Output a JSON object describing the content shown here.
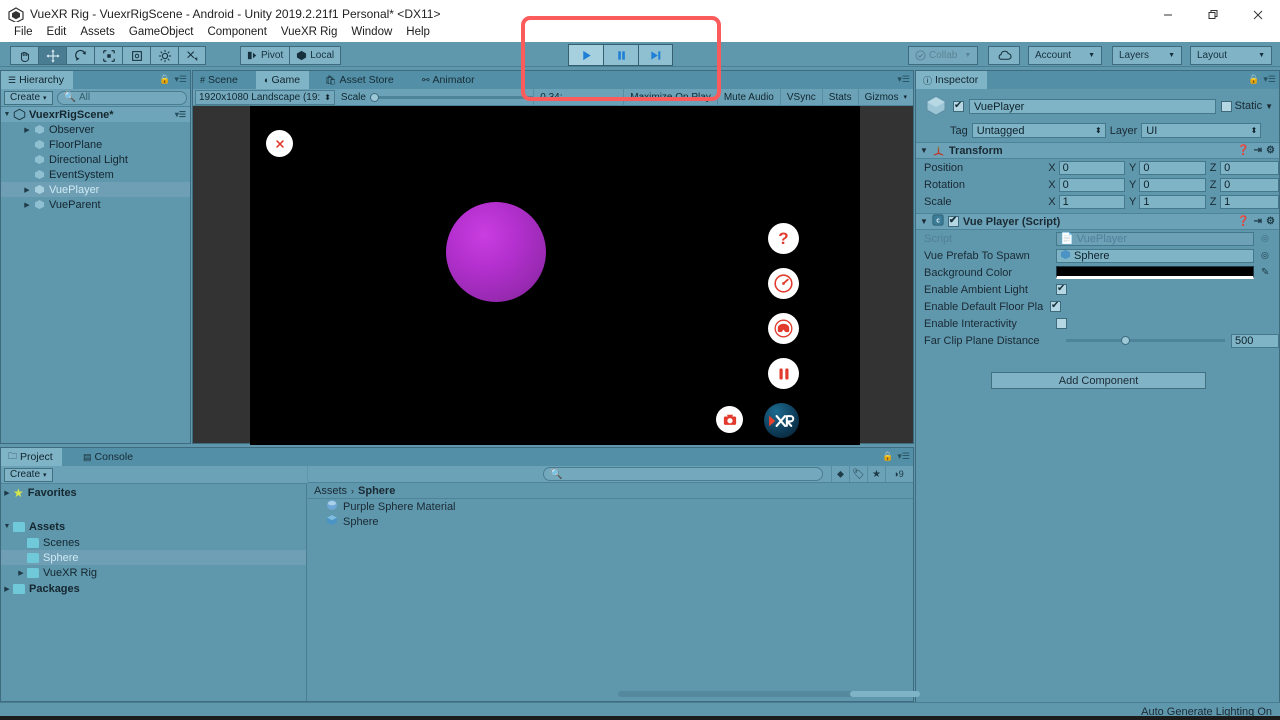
{
  "window": {
    "title": "VueXR Rig - VuexrRigScene - Android - Unity 2019.2.21f1 Personal* <DX11>",
    "minimize": "–",
    "maximize": "❐",
    "close": "✕"
  },
  "menu": {
    "items": [
      "File",
      "Edit",
      "Assets",
      "GameObject",
      "Component",
      "VueXR Rig",
      "Window",
      "Help"
    ]
  },
  "toolbar": {
    "tools": [
      {
        "name": "hand-tool",
        "glyph": "✋",
        "active": false
      },
      {
        "name": "move-tool",
        "glyph": "✥",
        "active": true
      },
      {
        "name": "rotate-tool",
        "glyph": "⟳",
        "active": false
      },
      {
        "name": "scale-tool",
        "glyph": "⤢",
        "active": false
      },
      {
        "name": "rect-tool",
        "glyph": "⬚",
        "active": false
      },
      {
        "name": "transform-tool",
        "glyph": "✦",
        "active": false
      },
      {
        "name": "custom-tool",
        "glyph": "✂",
        "active": false
      }
    ],
    "pivot_label": "Pivot",
    "local_label": "Local",
    "play_label": "▶",
    "pause_label": "❚❚",
    "step_label": "▶❙",
    "collab_label": "Collab",
    "cloud_label": "☁",
    "account_label": "Account",
    "layers_label": "Layers",
    "layout_label": "Layout"
  },
  "hierarchy": {
    "tab_label": "Hierarchy",
    "create_label": "Create",
    "search_placeholder": "All",
    "scene_name": "VuexrRigScene*",
    "items": [
      {
        "label": "Observer",
        "indent": 1,
        "expandable": true,
        "selected": false
      },
      {
        "label": "FloorPlane",
        "indent": 1,
        "expandable": false,
        "selected": false
      },
      {
        "label": "Directional Light",
        "indent": 1,
        "expandable": false,
        "selected": false
      },
      {
        "label": "EventSystem",
        "indent": 1,
        "expandable": false,
        "selected": false
      },
      {
        "label": "VuePlayer",
        "indent": 1,
        "expandable": true,
        "selected": true
      },
      {
        "label": "VueParent",
        "indent": 1,
        "expandable": true,
        "selected": false
      }
    ]
  },
  "gameview": {
    "tabs": [
      {
        "label": "Scene",
        "icon": "grid-icon",
        "active": false
      },
      {
        "label": "Game",
        "icon": "gamepad-icon",
        "active": true
      },
      {
        "label": "Asset Store",
        "icon": "store-icon",
        "active": false
      },
      {
        "label": "Animator",
        "icon": "animator-icon",
        "active": false
      }
    ],
    "resolution": "1920x1080 Landscape (19:",
    "scale_label": "Scale",
    "scale_value": "0.34:",
    "maximize_label": "Maximize On Play",
    "mute_label": "Mute Audio",
    "vsync_label": "VSync",
    "stats_label": "Stats",
    "gizmos_label": "Gizmos",
    "overlay": {
      "close_label": "✕",
      "help_label": "?",
      "buttons": [
        "close-button",
        "help-button",
        "gauge-button",
        "headset-button",
        "pause-button",
        "camera-button",
        "xr-badge"
      ]
    }
  },
  "inspector": {
    "tab_label": "Inspector",
    "object_name": "VuePlayer",
    "static_label": "Static",
    "tag_label": "Tag",
    "tag_value": "Untagged",
    "layer_label": "Layer",
    "layer_value": "UI",
    "transform": {
      "title": "Transform",
      "rows": [
        {
          "name": "Position",
          "x": "0",
          "y": "0",
          "z": "0"
        },
        {
          "name": "Rotation",
          "x": "0",
          "y": "0",
          "z": "0"
        },
        {
          "name": "Scale",
          "x": "1",
          "y": "1",
          "z": "1"
        }
      ]
    },
    "script_component": {
      "title": "Vue Player (Script)",
      "script_label": "Script",
      "script_value": "VuePlayer",
      "prefab_label": "Vue Prefab To Spawn",
      "prefab_value": "Sphere",
      "bgcolor_label": "Background Color",
      "bgcolor_value": "#000000",
      "ambient_label": "Enable Ambient Light",
      "ambient_checked": true,
      "floor_label": "Enable Default Floor Pla",
      "floor_checked": true,
      "interactivity_label": "Enable Interactivity",
      "interactivity_checked": false,
      "farclip_label": "Far Clip Plane Distance",
      "farclip_value": "500"
    },
    "add_component_label": "Add Component"
  },
  "project": {
    "tabs": [
      {
        "label": "Project",
        "active": true
      },
      {
        "label": "Console",
        "active": false
      }
    ],
    "create_label": "Create",
    "search_placeholder": "",
    "badge_count": "9",
    "tree": [
      {
        "label": "Favorites",
        "indent": 0,
        "bold": true,
        "expandable": true,
        "icon": "star",
        "selected": false
      },
      {
        "label": "Assets",
        "indent": 0,
        "bold": true,
        "expandable": true,
        "icon": "folder",
        "selected": false
      },
      {
        "label": "Scenes",
        "indent": 1,
        "bold": false,
        "expandable": false,
        "icon": "folder",
        "selected": false
      },
      {
        "label": "Sphere",
        "indent": 1,
        "bold": false,
        "expandable": false,
        "icon": "folder",
        "selected": true
      },
      {
        "label": "VueXR Rig",
        "indent": 1,
        "bold": false,
        "expandable": true,
        "icon": "folder",
        "selected": false
      },
      {
        "label": "Packages",
        "indent": 0,
        "bold": true,
        "expandable": true,
        "icon": "folder",
        "selected": false
      }
    ],
    "breadcrumb": [
      "Assets",
      "Sphere"
    ],
    "assets": [
      {
        "label": "Purple Sphere Material",
        "icon": "material-icon"
      },
      {
        "label": "Sphere",
        "icon": "prefab-icon"
      }
    ]
  },
  "statusbar": {
    "message": "Auto Generate Lighting On"
  },
  "colors": {
    "accent": "#5f97ad",
    "annotation": "#fb5b5b",
    "sphere": "#b430cf",
    "ar_red": "#e23b2e"
  }
}
